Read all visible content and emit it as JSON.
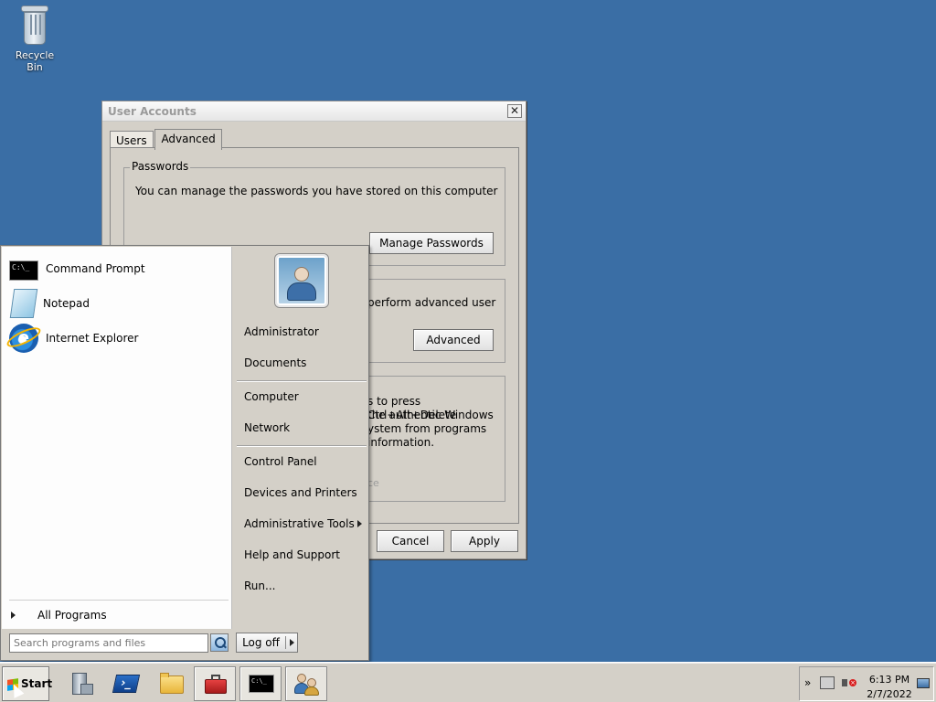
{
  "desktop": {
    "recycle_bin_label": "Recycle Bin"
  },
  "window": {
    "title": "User Accounts",
    "close_glyph": "✕",
    "tabs": [
      {
        "label": "Users",
        "active": false
      },
      {
        "label": "Advanced",
        "active": true
      }
    ],
    "passwords_group": {
      "title": "Passwords",
      "text": "You can manage the passwords you have stored on this computer",
      "button": "Manage Passwords"
    },
    "advanced_group": {
      "text_visible": "perform advanced user",
      "button": "Advanced"
    },
    "secure_logon_group": {
      "lines": [
        "s to press Ctrl+Alt+Delete",
        "the authentic Windows",
        "ystem from programs",
        "information."
      ],
      "dim_text": "ce"
    },
    "buttons": {
      "cancel": "Cancel",
      "apply": "Apply"
    }
  },
  "start_menu": {
    "programs": [
      {
        "label": "Command Prompt",
        "icon": "cmd-icon",
        "icon_text": "C:\\_"
      },
      {
        "label": "Notepad",
        "icon": "notepad-icon"
      },
      {
        "label": "Internet Explorer",
        "icon": "ie-icon",
        "icon_text": "e"
      }
    ],
    "all_programs": "All Programs",
    "right_items": {
      "user": "Administrator",
      "documents": "Documents",
      "computer": "Computer",
      "network": "Network",
      "control_panel": "Control Panel",
      "devices_printers": "Devices and Printers",
      "admin_tools": "Administrative Tools",
      "help_support": "Help and Support",
      "run": "Run..."
    },
    "search_placeholder": "Search programs and files",
    "log_off": "Log off"
  },
  "taskbar": {
    "start_label": "Start",
    "clock_time": "6:13 PM",
    "clock_date": "2/7/2022",
    "tray_expand_glyph": "»",
    "cmd_icon_text": "C:\\_",
    "colors": {
      "desktop": "#3a6ea5",
      "chrome": "#d4d0c8"
    }
  }
}
